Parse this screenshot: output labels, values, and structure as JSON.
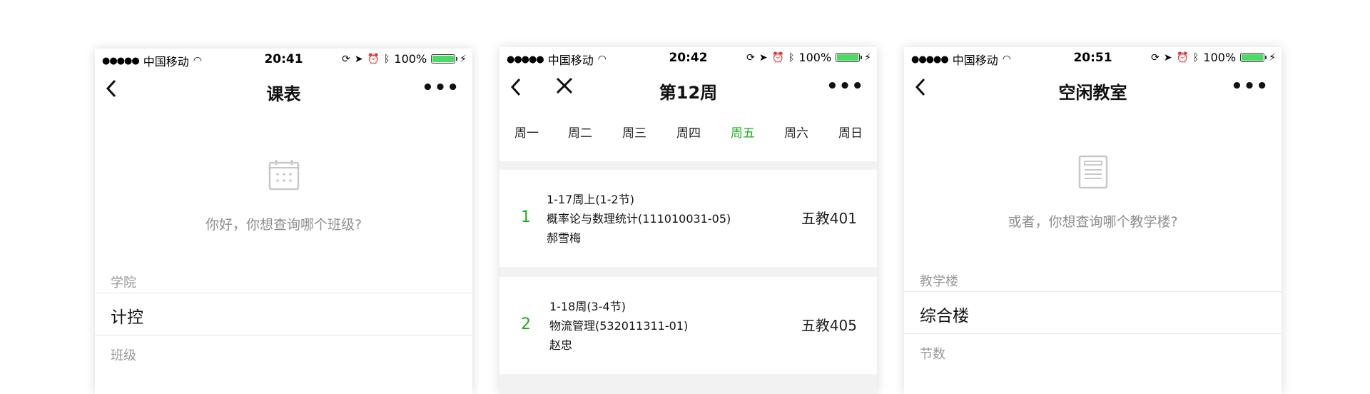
{
  "screens": [
    {
      "status": {
        "carrier": "中国移动",
        "time": "20:41",
        "battery": "100%"
      },
      "title": "课表",
      "prompt": "你好，你想查询哪个班级?",
      "fields": [
        {
          "label": "学院",
          "value": "计控"
        },
        {
          "label": "班级"
        }
      ]
    },
    {
      "status": {
        "carrier": "中国移动",
        "time": "20:42",
        "battery": "100%"
      },
      "title": "第12周",
      "weekdays": [
        "周一",
        "周二",
        "周三",
        "周四",
        "周五",
        "周六",
        "周日"
      ],
      "active_day": "周五",
      "courses": [
        {
          "index": "1",
          "weeks": "1-17周上(1-2节)",
          "name": "概率论与数理统计(111010031-05)",
          "teacher": "郝雪梅",
          "room": "五教401"
        },
        {
          "index": "2",
          "weeks": "1-18周(3-4节)",
          "name": "物流管理(532011311-01)",
          "teacher": "赵忠",
          "room": "五教405"
        }
      ]
    },
    {
      "status": {
        "carrier": "中国移动",
        "time": "20:51",
        "battery": "100%"
      },
      "title": "空闲教室",
      "prompt": "或者，你想查询哪个教学楼?",
      "fields": [
        {
          "label": "教学楼",
          "value": "综合楼"
        },
        {
          "label": "节数"
        }
      ]
    }
  ],
  "colors": {
    "accent": "#1aad19",
    "muted": "#999999",
    "battery": "#4cd964",
    "separator": "#f2f2f2"
  },
  "icons": {
    "back": "chevron-left-icon",
    "close": "close-icon",
    "more": "more-dots-icon",
    "calendar": "calendar-icon",
    "building": "building-icon"
  }
}
